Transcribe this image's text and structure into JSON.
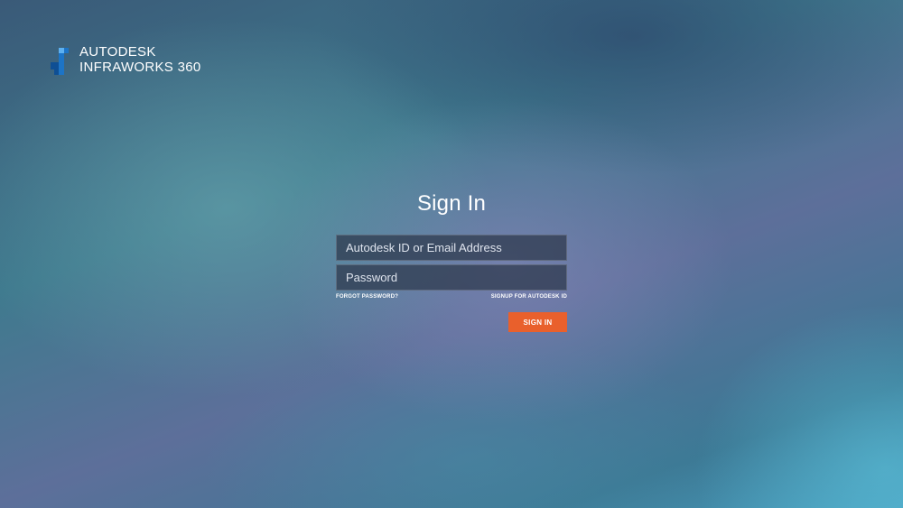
{
  "logo": {
    "brand": "AUTODESK",
    "product": "INFRAWORKS 360",
    "icon": "autodesk-logo-icon"
  },
  "form": {
    "title": "Sign In",
    "id_placeholder": "Autodesk ID or Email Address",
    "id_value": "",
    "password_placeholder": "Password",
    "password_value": "",
    "forgot_label": "FORGOT PASSWORD?",
    "signup_label": "SIGNUP FOR AUTODESK ID",
    "signin_label": "SIGN IN"
  },
  "colors": {
    "accent": "#e9602c",
    "field_bg": "#2d374b",
    "text": "#ffffff"
  }
}
